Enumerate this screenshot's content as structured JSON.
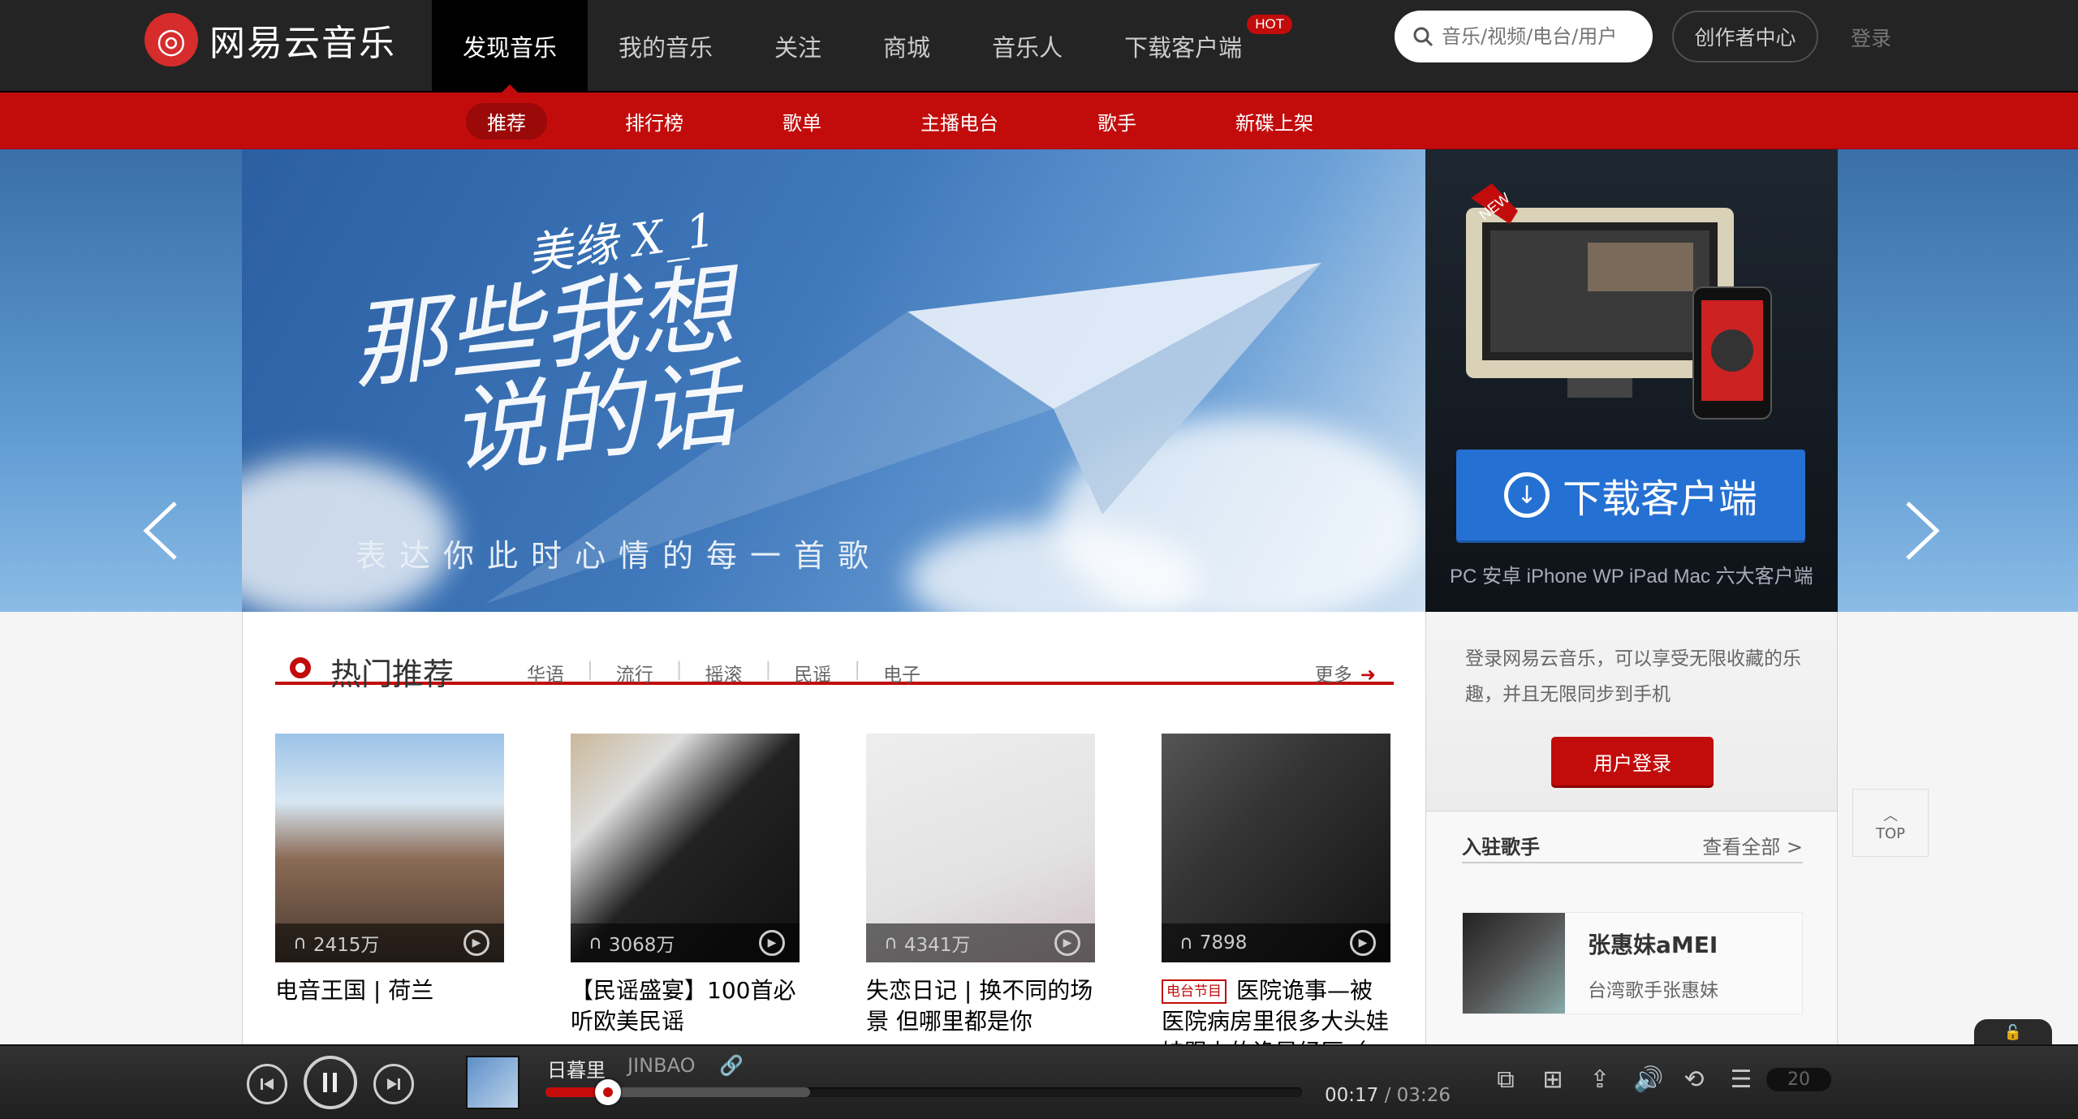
{
  "brand": {
    "logo_glyph": "◎",
    "name": "网易云音乐",
    "accent": "#c20c0c"
  },
  "nav": {
    "items": [
      "发现音乐",
      "我的音乐",
      "关注",
      "商城",
      "音乐人",
      "下载客户端"
    ],
    "hot_badge": "HOT"
  },
  "search": {
    "placeholder": "音乐/视频/电台/用户"
  },
  "creator_label": "创作者中心",
  "login_label": "登录",
  "subnav": [
    "推荐",
    "排行榜",
    "歌单",
    "主播电台",
    "歌手",
    "新碟上架"
  ],
  "banner": {
    "small_script": "美缘 X_1",
    "title_line1": "那些我想",
    "title_line2": "说的话",
    "subtitle": "表达你此时心情的每一首歌",
    "dot_count": 8,
    "active_dot": 0
  },
  "download": {
    "new_badge": "NEW",
    "button_label": "下载客户端",
    "caption": "PC 安卓 iPhone WP iPad Mac 六大客户端"
  },
  "hot": {
    "title": "热门推荐",
    "tags": [
      "华语",
      "流行",
      "摇滚",
      "民谣",
      "电子"
    ],
    "more": "更多"
  },
  "cards": [
    {
      "plays": "2415万",
      "title": "电音王国 | 荷兰",
      "tag": ""
    },
    {
      "plays": "3068万",
      "title": "【民谣盛宴】100首必听欧美民谣",
      "tag": ""
    },
    {
      "plays": "4341万",
      "title": "失恋日记 | 换不同的场景 但哪里都是你",
      "tag": ""
    },
    {
      "plays": "7898",
      "title": "医院诡事—被医院病房里很多大头娃娃跟上的诡异经历（...",
      "tag": "电台节目"
    }
  ],
  "side": {
    "login_text": "登录网易云音乐，可以享受无限收藏的乐趣，并且无限同步到手机",
    "login_button": "用户登录",
    "singer_head": "入驻歌手",
    "view_all": "查看全部 >",
    "singer_name": "张惠妹aMEI",
    "singer_desc": "台湾歌手张惠妹"
  },
  "top_button": "TOP",
  "player": {
    "song": "日暮里",
    "artist": "JINBAO",
    "elapsed": "00:17",
    "total": "03:26",
    "progress": 0.0825,
    "buffered": 0.35,
    "playlist_count": "20"
  }
}
